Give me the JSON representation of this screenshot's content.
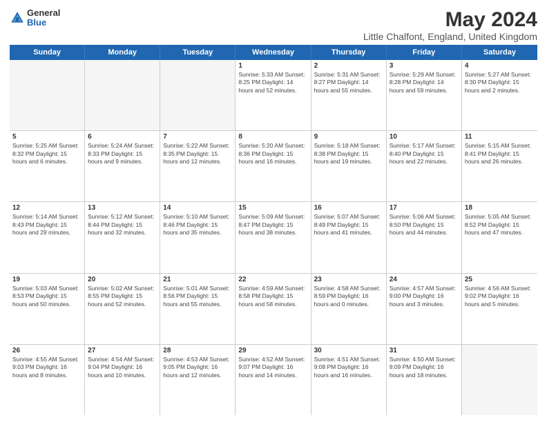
{
  "logo": {
    "general": "General",
    "blue": "Blue"
  },
  "title": "May 2024",
  "subtitle": "Little Chalfont, England, United Kingdom",
  "weekdays": [
    "Sunday",
    "Monday",
    "Tuesday",
    "Wednesday",
    "Thursday",
    "Friday",
    "Saturday"
  ],
  "weeks": [
    [
      {
        "day": "",
        "text": "",
        "empty": true
      },
      {
        "day": "",
        "text": "",
        "empty": true
      },
      {
        "day": "",
        "text": "",
        "empty": true
      },
      {
        "day": "1",
        "text": "Sunrise: 5:33 AM\nSunset: 8:25 PM\nDaylight: 14 hours\nand 52 minutes."
      },
      {
        "day": "2",
        "text": "Sunrise: 5:31 AM\nSunset: 8:27 PM\nDaylight: 14 hours\nand 55 minutes."
      },
      {
        "day": "3",
        "text": "Sunrise: 5:29 AM\nSunset: 8:28 PM\nDaylight: 14 hours\nand 59 minutes."
      },
      {
        "day": "4",
        "text": "Sunrise: 5:27 AM\nSunset: 8:30 PM\nDaylight: 15 hours\nand 2 minutes."
      }
    ],
    [
      {
        "day": "5",
        "text": "Sunrise: 5:25 AM\nSunset: 8:32 PM\nDaylight: 15 hours\nand 6 minutes."
      },
      {
        "day": "6",
        "text": "Sunrise: 5:24 AM\nSunset: 8:33 PM\nDaylight: 15 hours\nand 9 minutes."
      },
      {
        "day": "7",
        "text": "Sunrise: 5:22 AM\nSunset: 8:35 PM\nDaylight: 15 hours\nand 12 minutes."
      },
      {
        "day": "8",
        "text": "Sunrise: 5:20 AM\nSunset: 8:36 PM\nDaylight: 15 hours\nand 16 minutes."
      },
      {
        "day": "9",
        "text": "Sunrise: 5:18 AM\nSunset: 8:38 PM\nDaylight: 15 hours\nand 19 minutes."
      },
      {
        "day": "10",
        "text": "Sunrise: 5:17 AM\nSunset: 8:40 PM\nDaylight: 15 hours\nand 22 minutes."
      },
      {
        "day": "11",
        "text": "Sunrise: 5:15 AM\nSunset: 8:41 PM\nDaylight: 15 hours\nand 26 minutes."
      }
    ],
    [
      {
        "day": "12",
        "text": "Sunrise: 5:14 AM\nSunset: 8:43 PM\nDaylight: 15 hours\nand 29 minutes."
      },
      {
        "day": "13",
        "text": "Sunrise: 5:12 AM\nSunset: 8:44 PM\nDaylight: 15 hours\nand 32 minutes."
      },
      {
        "day": "14",
        "text": "Sunrise: 5:10 AM\nSunset: 8:46 PM\nDaylight: 15 hours\nand 35 minutes."
      },
      {
        "day": "15",
        "text": "Sunrise: 5:09 AM\nSunset: 8:47 PM\nDaylight: 15 hours\nand 38 minutes."
      },
      {
        "day": "16",
        "text": "Sunrise: 5:07 AM\nSunset: 8:49 PM\nDaylight: 15 hours\nand 41 minutes."
      },
      {
        "day": "17",
        "text": "Sunrise: 5:06 AM\nSunset: 8:50 PM\nDaylight: 15 hours\nand 44 minutes."
      },
      {
        "day": "18",
        "text": "Sunrise: 5:05 AM\nSunset: 8:52 PM\nDaylight: 15 hours\nand 47 minutes."
      }
    ],
    [
      {
        "day": "19",
        "text": "Sunrise: 5:03 AM\nSunset: 8:53 PM\nDaylight: 15 hours\nand 50 minutes."
      },
      {
        "day": "20",
        "text": "Sunrise: 5:02 AM\nSunset: 8:55 PM\nDaylight: 15 hours\nand 52 minutes."
      },
      {
        "day": "21",
        "text": "Sunrise: 5:01 AM\nSunset: 8:56 PM\nDaylight: 15 hours\nand 55 minutes."
      },
      {
        "day": "22",
        "text": "Sunrise: 4:59 AM\nSunset: 8:58 PM\nDaylight: 15 hours\nand 58 minutes."
      },
      {
        "day": "23",
        "text": "Sunrise: 4:58 AM\nSunset: 8:59 PM\nDaylight: 16 hours\nand 0 minutes."
      },
      {
        "day": "24",
        "text": "Sunrise: 4:57 AM\nSunset: 9:00 PM\nDaylight: 16 hours\nand 3 minutes."
      },
      {
        "day": "25",
        "text": "Sunrise: 4:56 AM\nSunset: 9:02 PM\nDaylight: 16 hours\nand 5 minutes."
      }
    ],
    [
      {
        "day": "26",
        "text": "Sunrise: 4:55 AM\nSunset: 9:03 PM\nDaylight: 16 hours\nand 8 minutes."
      },
      {
        "day": "27",
        "text": "Sunrise: 4:54 AM\nSunset: 9:04 PM\nDaylight: 16 hours\nand 10 minutes."
      },
      {
        "day": "28",
        "text": "Sunrise: 4:53 AM\nSunset: 9:05 PM\nDaylight: 16 hours\nand 12 minutes."
      },
      {
        "day": "29",
        "text": "Sunrise: 4:52 AM\nSunset: 9:07 PM\nDaylight: 16 hours\nand 14 minutes."
      },
      {
        "day": "30",
        "text": "Sunrise: 4:51 AM\nSunset: 9:08 PM\nDaylight: 16 hours\nand 16 minutes."
      },
      {
        "day": "31",
        "text": "Sunrise: 4:50 AM\nSunset: 9:09 PM\nDaylight: 16 hours\nand 18 minutes."
      },
      {
        "day": "",
        "text": "",
        "empty": true
      }
    ]
  ]
}
